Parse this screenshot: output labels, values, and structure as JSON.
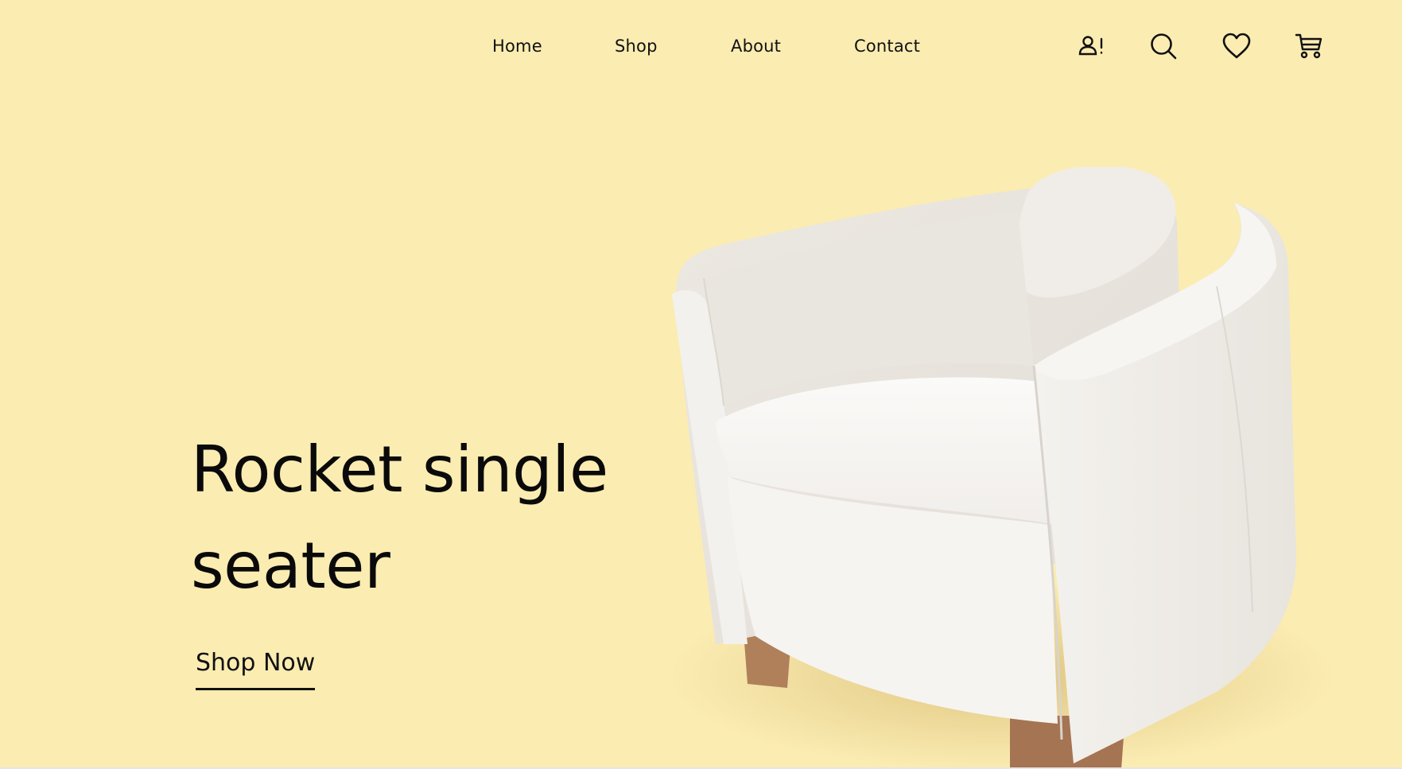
{
  "nav": {
    "links": [
      "Home",
      "Shop",
      "About",
      "Contact"
    ]
  },
  "header_icons": [
    "account-alert-icon",
    "search-icon",
    "heart-icon",
    "cart-icon"
  ],
  "hero": {
    "title": "Rocket single seater",
    "cta_label": "Shop Now",
    "image": "white armchair photo"
  },
  "colors": {
    "background": "#fbecb2",
    "text": "#0a0a0a",
    "chair": "#f3f0ec",
    "chair_legs": "#b0805a"
  }
}
